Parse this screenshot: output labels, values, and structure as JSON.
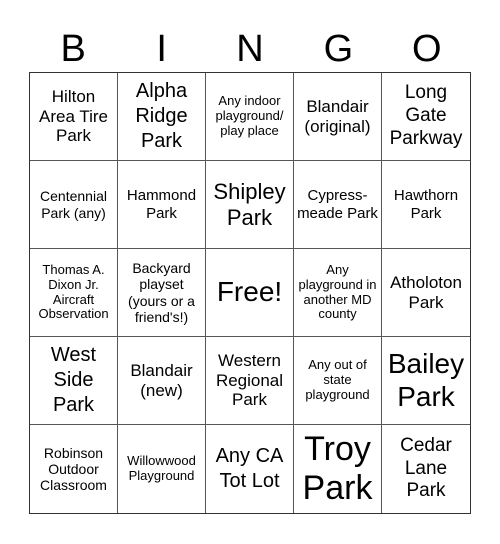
{
  "header": {
    "letters": [
      "B",
      "I",
      "N",
      "G",
      "O"
    ]
  },
  "cells": [
    "Hilton Area Tire Park",
    "Alpha Ridge Park",
    "Any indoor playground/ play place",
    "Blandair (original)",
    "Long Gate Parkway",
    "Centennial Park (any)",
    "Hammond Park",
    "Shipley Park",
    "Cypress-meade Park",
    "Hawthorn Park",
    "Thomas A. Dixon Jr. Aircraft Observation",
    "Backyard playset (yours or a friend's!)",
    "Free!",
    "Any playground in another MD county",
    "Atholoton Park",
    "West Side Park",
    "Blandair (new)",
    "Western Regional Park",
    "Any out of state playground",
    "Bailey Park",
    "Robinson Outdoor Classroom",
    "Willowwood Playground",
    "Any CA Tot Lot",
    "Troy Park",
    "Cedar Lane Park"
  ]
}
